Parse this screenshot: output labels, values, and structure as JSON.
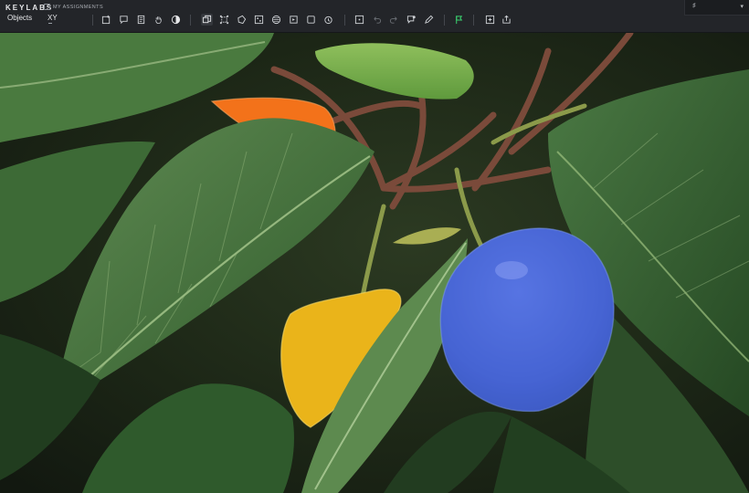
{
  "header": {
    "brand": "KEYLABS",
    "breadcrumb": "MY ASSIGNMENTS"
  },
  "tabs": [
    {
      "label": "Objects"
    },
    {
      "label": "XY"
    }
  ],
  "toolbar": {
    "icons": [
      "new-object-icon",
      "comment-icon",
      "document-icon",
      "hand-icon",
      "contrast-icon",
      "copy-icon",
      "bounding-box-icon",
      "polygon-icon",
      "points-icon",
      "mask-icon",
      "cuboid-icon",
      "layer-icon",
      "frame-icon",
      "timer-icon",
      "crosshair-icon",
      "undo-icon",
      "redo-icon",
      "comment-add-icon",
      "pen-icon",
      "flag-icon",
      "save-icon",
      "export-icon"
    ],
    "accent_color": "#3bd16f"
  },
  "window": {
    "volume_icon": "volume-icon",
    "menu_icon": "chevron-down-icon"
  },
  "annotations": [
    {
      "label": "orange",
      "color": "#ff7a1a"
    },
    {
      "label": "yellow",
      "color": "#f6c11a"
    },
    {
      "label": "blue",
      "color": "#3f6fe6"
    }
  ]
}
